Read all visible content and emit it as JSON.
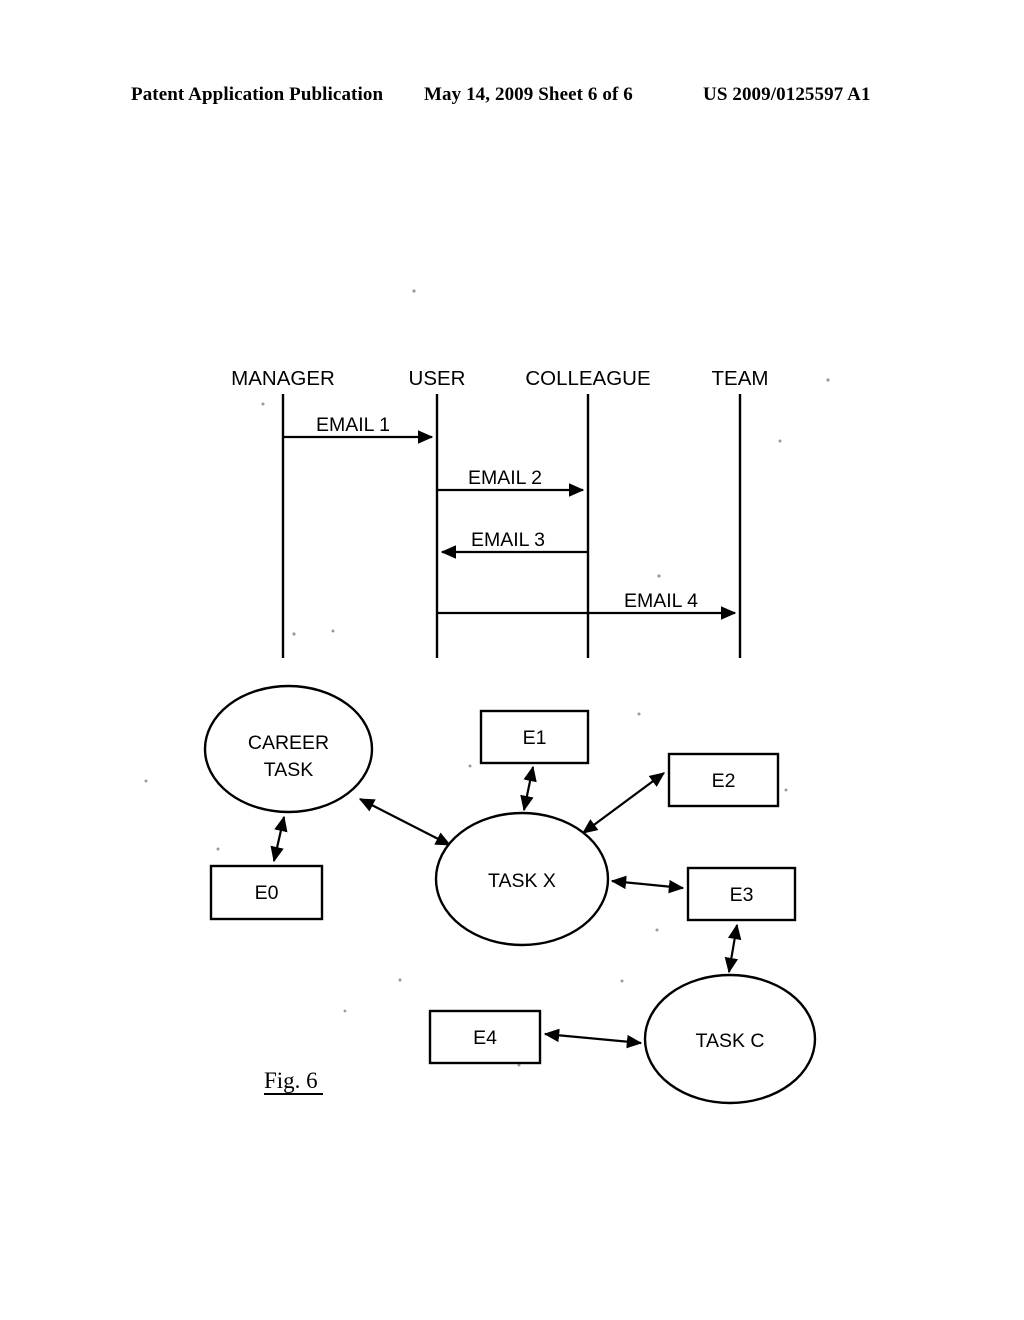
{
  "header": {
    "publication": "Patent Application Publication",
    "date_sheet": "May 14, 2009  Sheet 6 of 6",
    "patent_number": "US 2009/0125597 A1"
  },
  "figure": {
    "caption": "Fig. 6"
  },
  "sequence_diagram": {
    "actors": [
      {
        "id": "manager",
        "label": "MANAGER"
      },
      {
        "id": "user",
        "label": "USER"
      },
      {
        "id": "colleague",
        "label": "COLLEAGUE"
      },
      {
        "id": "team",
        "label": "TEAM"
      }
    ],
    "messages": [
      {
        "id": "m1",
        "label": "EMAIL 1",
        "from": "MANAGER",
        "to": "USER",
        "direction": "right"
      },
      {
        "id": "m2",
        "label": "EMAIL 2",
        "from": "USER",
        "to": "COLLEAGUE",
        "direction": "right"
      },
      {
        "id": "m3",
        "label": "EMAIL 3",
        "from": "COLLEAGUE",
        "to": "USER",
        "direction": "left"
      },
      {
        "id": "m4",
        "label": "EMAIL 4",
        "from": "USER",
        "to": "TEAM",
        "direction": "right"
      }
    ]
  },
  "task_graph": {
    "nodes": [
      {
        "id": "career_task",
        "label_line1": "CAREER",
        "label_line2": "TASK",
        "shape": "ellipse"
      },
      {
        "id": "task_x",
        "label_line1": "TASK X",
        "label_line2": "",
        "shape": "ellipse"
      },
      {
        "id": "task_c",
        "label_line1": "TASK C",
        "label_line2": "",
        "shape": "ellipse"
      },
      {
        "id": "e0",
        "label_line1": "E0",
        "label_line2": "",
        "shape": "rect"
      },
      {
        "id": "e1",
        "label_line1": "E1",
        "label_line2": "",
        "shape": "rect"
      },
      {
        "id": "e2",
        "label_line1": "E2",
        "label_line2": "",
        "shape": "rect"
      },
      {
        "id": "e3",
        "label_line1": "E3",
        "label_line2": "",
        "shape": "rect"
      },
      {
        "id": "e4",
        "label_line1": "E4",
        "label_line2": "",
        "shape": "rect"
      }
    ],
    "edges": [
      {
        "id": "edge-e0-career",
        "from": "e0",
        "to": "career_task",
        "arrows": "both"
      },
      {
        "id": "edge-career-taskx",
        "from": "career_task",
        "to": "task_x",
        "arrows": "both"
      },
      {
        "id": "edge-e1-taskx",
        "from": "e1",
        "to": "task_x",
        "arrows": "both"
      },
      {
        "id": "edge-e2-taskx",
        "from": "e2",
        "to": "task_x",
        "arrows": "both"
      },
      {
        "id": "edge-e3-taskx",
        "from": "e3",
        "to": "task_x",
        "arrows": "both"
      },
      {
        "id": "edge-e3-taskc",
        "from": "e3",
        "to": "task_c",
        "arrows": "both"
      },
      {
        "id": "edge-e4-taskc",
        "from": "e4",
        "to": "task_c",
        "arrows": "both"
      }
    ]
  },
  "colors": {
    "ink": "#000000",
    "paper": "#ffffff"
  }
}
